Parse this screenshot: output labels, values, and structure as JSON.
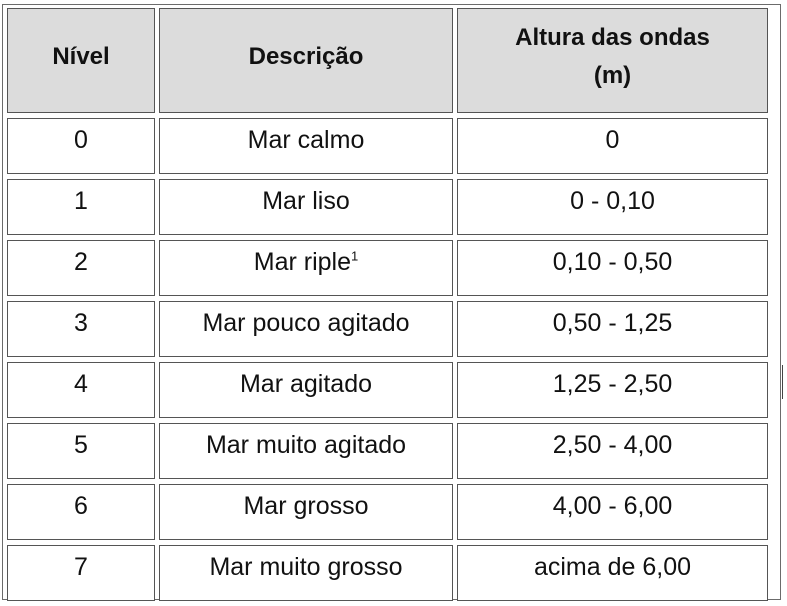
{
  "table": {
    "headers": {
      "level": "Nível",
      "description": "Descrição",
      "height_line1": "Altura das ondas",
      "height_line2": "(m)"
    },
    "rows": [
      {
        "level": "0",
        "description": "Mar calmo",
        "height": "0"
      },
      {
        "level": "1",
        "description": "Mar liso",
        "height": "0 - 0,10"
      },
      {
        "level": "2",
        "description": "Mar riple",
        "footnote": "1",
        "height": "0,10 - 0,50"
      },
      {
        "level": "3",
        "description": "Mar pouco agitado",
        "height": "0,50 - 1,25"
      },
      {
        "level": "4",
        "description": "Mar agitado",
        "height": "1,25 - 2,50"
      },
      {
        "level": "5",
        "description": "Mar muito agitado",
        "height": "2,50 - 4,00"
      },
      {
        "level": "6",
        "description": "Mar grosso",
        "height": "4,00 - 6,00"
      },
      {
        "level": "7",
        "description": "Mar muito grosso",
        "height": "acima de 6,00"
      }
    ]
  },
  "colors": {
    "header_background": "#dcdcdc",
    "border": "#555555"
  }
}
